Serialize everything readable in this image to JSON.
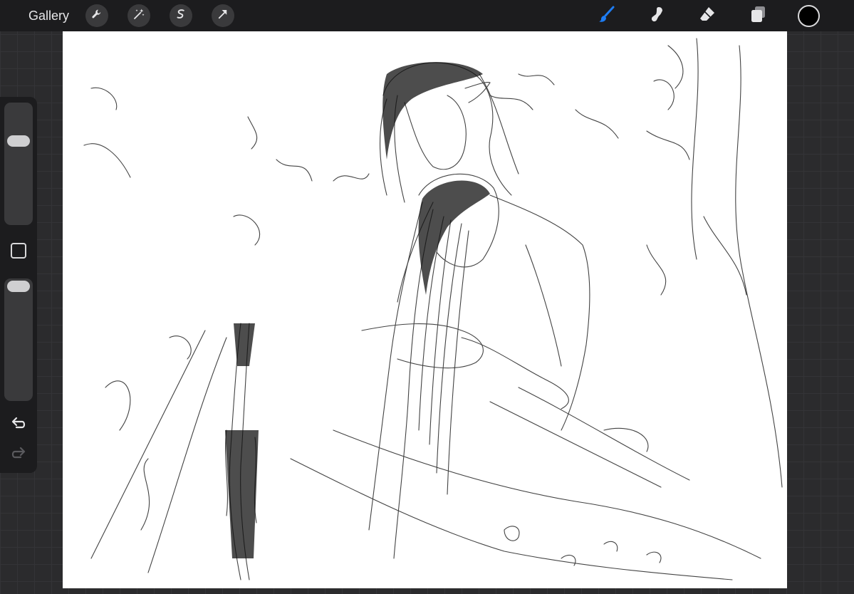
{
  "topbar": {
    "gallery_label": "Gallery",
    "left_tools": [
      "wrench-icon",
      "magic-wand-icon",
      "selection-s-icon",
      "transform-arrow-icon"
    ],
    "right_tools": [
      "brush-icon",
      "smudge-icon",
      "eraser-icon",
      "layers-icon"
    ],
    "active_tool": "brush-icon",
    "current_color": "#000000",
    "accent_color": "#1e7cf2"
  },
  "sidebar": {
    "brush_size_level": 0.85,
    "opacity_level": 0.95,
    "icons": [
      "modify-square-icon",
      "undo-icon",
      "redo-icon"
    ]
  },
  "canvas": {
    "background": "#ffffff",
    "content": "pencil-sketch"
  }
}
